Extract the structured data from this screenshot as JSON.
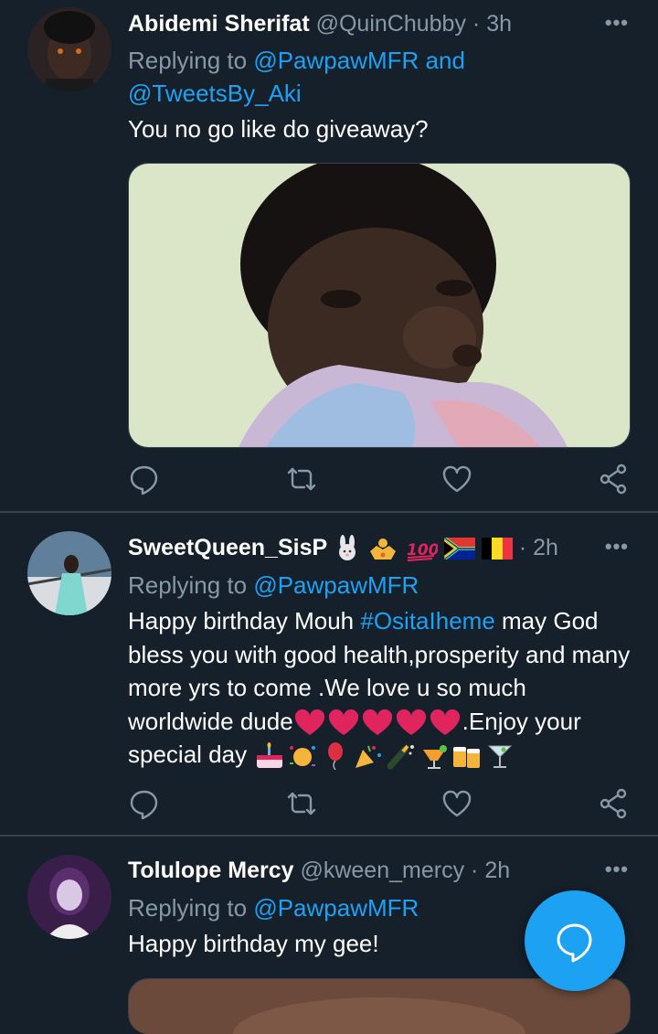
{
  "tweets": [
    {
      "display_name": "Abidemi Sherifat",
      "handle": "@QuinChubby",
      "time": "3h",
      "replying_label": "Replying to",
      "mentions": [
        "@PawpawMFR",
        "@TweetsBy_Aki"
      ],
      "mention_joiner": "and",
      "text": "You no go like do giveaway?"
    },
    {
      "display_name": "SweetQueen_SisP",
      "name_emojis": [
        "rabbit-emoji",
        "crown-emoji",
        "hundred-points-emoji",
        "south-africa-flag",
        "belgium-flag"
      ],
      "time": "2h",
      "replying_label": "Replying to",
      "mentions": [
        "@PawpawMFR"
      ],
      "text_before_hashtag": "Happy birthday Mouh ",
      "hashtag": "#OsitaIheme",
      "text_after_hashtag": " may God bless you with good health,prosperity and many more yrs to come .We love u so much worldwide  dude",
      "hearts_count": 5,
      "text_after_hearts": ".Enjoy your special day ",
      "trailing_emojis": [
        "birthday-cake-emoji",
        "confetti-emoji",
        "balloon-emoji",
        "party-popper-emoji",
        "champagne-emoji",
        "tropical-drink-emoji",
        "beer-mugs-emoji",
        "cocktail-emoji"
      ]
    },
    {
      "display_name": "Tolulope Mercy",
      "handle": "@kween_mercy",
      "time": "2h",
      "replying_label": "Replying to",
      "mentions": [
        "@PawpawMFR"
      ],
      "text": "Happy birthday my gee!"
    }
  ],
  "separator": "·",
  "more_label": "•••",
  "actions": [
    "reply-icon",
    "retweet-icon",
    "like-icon",
    "share-icon"
  ],
  "fab_icon": "compose-reply-icon",
  "colors": {
    "background": "#15202b",
    "accent": "#1da1f2",
    "secondary_text": "#8899a6",
    "divider": "#38444d",
    "heart": "#e0245e"
  }
}
